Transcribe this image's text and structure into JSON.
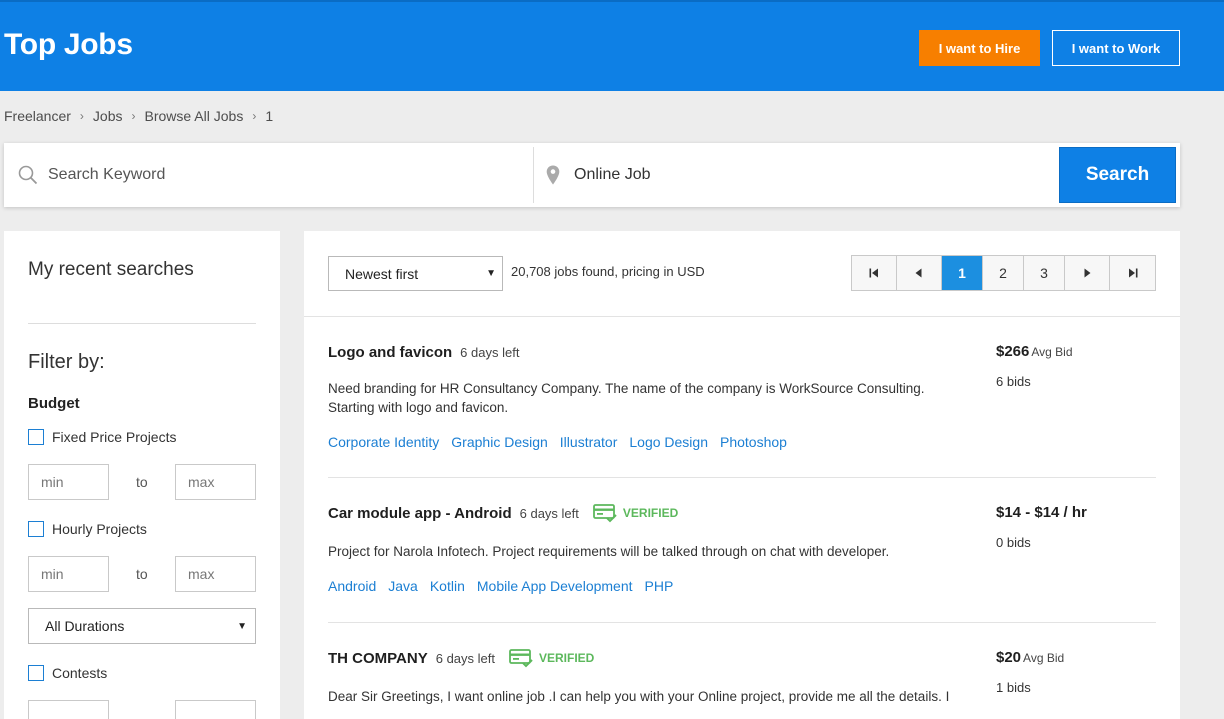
{
  "header": {
    "title": "Top Jobs",
    "hire_label": "I want to Hire",
    "work_label": "I want to Work",
    "brand_color": "#0e80e5",
    "hire_color": "#f77f00"
  },
  "breadcrumb": [
    "Freelancer",
    "Jobs",
    "Browse All Jobs",
    "1"
  ],
  "search": {
    "keyword_placeholder": "Search Keyword",
    "location_value": "Online Job",
    "button_label": "Search"
  },
  "sidebar": {
    "recent_title": "My recent searches",
    "filter_title": "Filter by:",
    "budget_title": "Budget",
    "fixed_label": "Fixed Price Projects",
    "hourly_label": "Hourly Projects",
    "min_placeholder": "min",
    "max_placeholder": "max",
    "to_label": "to",
    "duration_value": "All Durations",
    "contests_label": "Contests"
  },
  "results": {
    "sort_value": "Newest first",
    "count_text": "20,708 jobs found, pricing in USD",
    "pages": [
      "1",
      "2",
      "3"
    ],
    "active_page": "1"
  },
  "jobs": [
    {
      "title": "Logo and favicon",
      "time_left": "6 days left",
      "verified": false,
      "description": "Need branding for HR Consultancy Company. The name of the company is WorkSource Consulting. Starting with logo and favicon.",
      "tags": [
        "Corporate Identity",
        "Graphic Design",
        "Illustrator",
        "Logo Design",
        "Photoshop"
      ],
      "price": "$266",
      "price_suffix": "Avg Bid",
      "bids": "6 bids"
    },
    {
      "title": "Car module app - Android",
      "time_left": "6 days left",
      "verified": true,
      "verified_label": "VERIFIED",
      "description": "Project for Narola Infotech. Project requirements will be talked through on chat with developer.",
      "tags": [
        "Android",
        "Java",
        "Kotlin",
        "Mobile App Development",
        "PHP"
      ],
      "price": "$14 - $14 / hr",
      "price_suffix": "",
      "bids": "0 bids"
    },
    {
      "title": "TH COMPANY",
      "time_left": "6 days left",
      "verified": true,
      "verified_label": "VERIFIED",
      "description": "Dear Sir Greetings, I want online job .I can help you with your Online project, provide me all the details. I",
      "tags": [],
      "price": "$20",
      "price_suffix": "Avg Bid",
      "bids": "1 bids"
    }
  ]
}
